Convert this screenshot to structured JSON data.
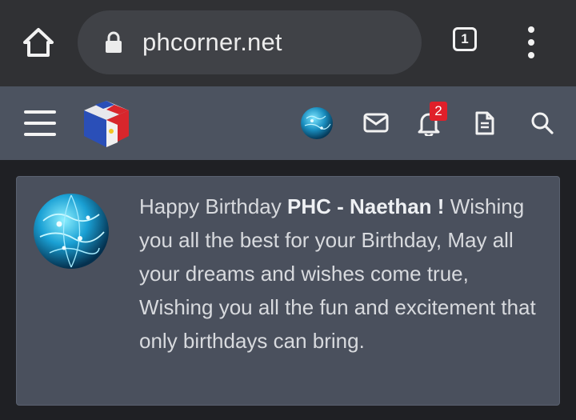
{
  "browser": {
    "url": "phcorner.net",
    "tab_count": "1",
    "icons": {
      "home": "home-icon",
      "lock": "lock-icon",
      "tabs": "tabs-icon",
      "menu": "more-vert-icon"
    }
  },
  "site_nav": {
    "notification_badge": "2",
    "icons": [
      "menu-icon",
      "site-logo",
      "avatar",
      "mail-icon",
      "bell-icon",
      "document-icon",
      "search-icon"
    ]
  },
  "message": {
    "greeting_prefix": "Happy Birthday ",
    "recipient": "PHC - Naethan !",
    "body": "Wishing you all the best for your Birthday, May all your dreams and wishes come true, Wishing you all the fun and excitement that only birthdays can bring."
  },
  "colors": {
    "browser_bar": "#303134",
    "url_pill": "#404247",
    "site_nav": "#4c5360",
    "card": "#4a505d",
    "badge": "#e0202a",
    "page_bg": "#1f2024"
  }
}
